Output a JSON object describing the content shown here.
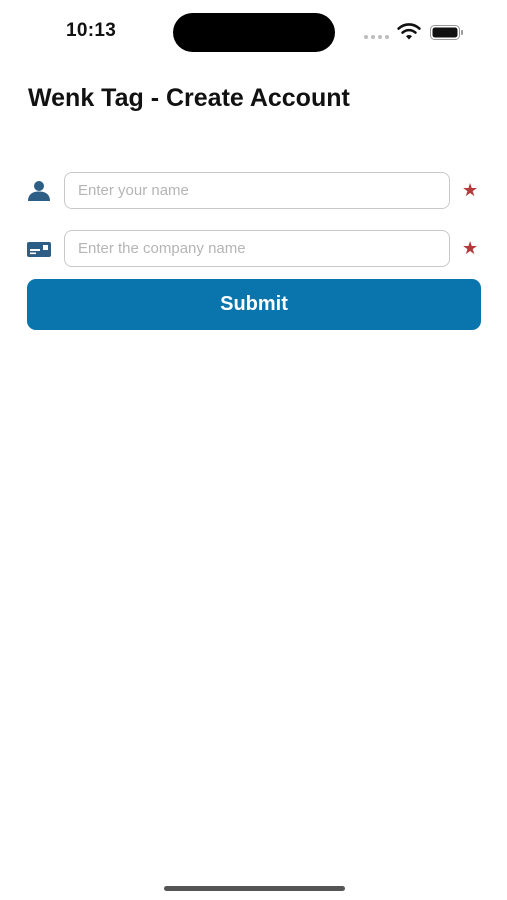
{
  "status_bar": {
    "time": "10:13"
  },
  "header": {
    "title": "Wenk Tag - Create Account"
  },
  "form": {
    "name_field": {
      "icon": "person-icon",
      "placeholder": "Enter your name",
      "value": "",
      "required_mark": "★"
    },
    "company_field": {
      "icon": "id-card-icon",
      "placeholder": "Enter the company name",
      "value": "",
      "required_mark": "★"
    },
    "submit_label": "Submit"
  },
  "colors": {
    "accent": "#0a74ac",
    "icon": "#2d5f86",
    "required_star": "#b23a3a",
    "input_border": "#c9c9c9",
    "placeholder": "#b5b5b5"
  }
}
